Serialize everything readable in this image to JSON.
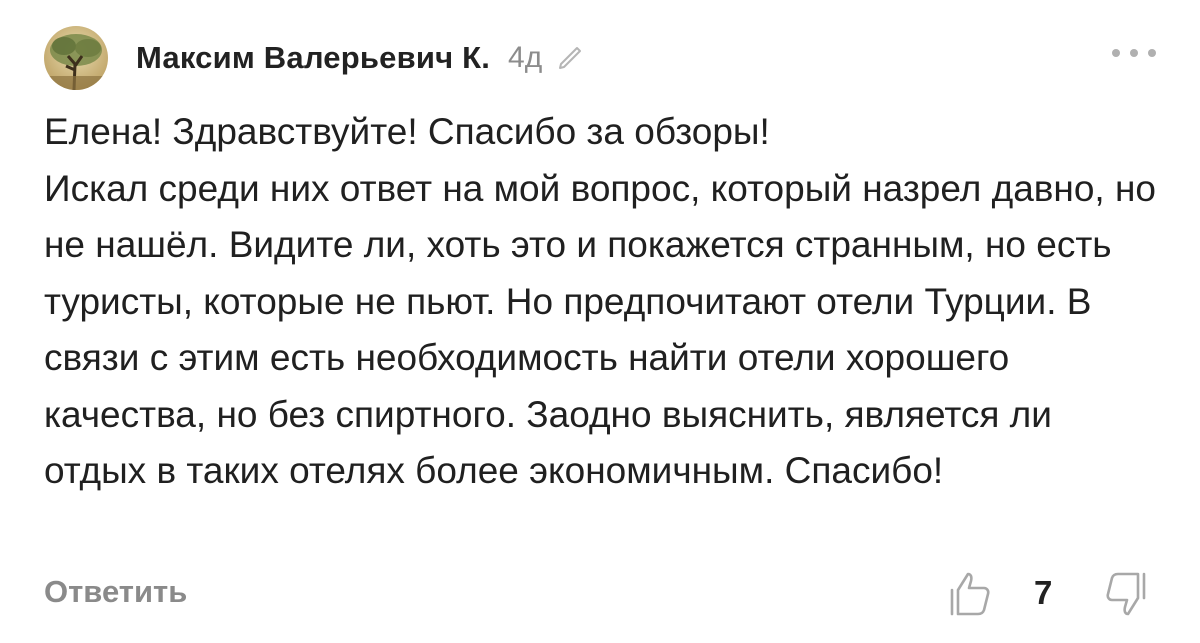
{
  "comment": {
    "author": "Максим Валерьевич К.",
    "time": "4д",
    "text": "Елена! Здравствуйте! Спасибо за обзоры!\nИскал среди них ответ на мой вопрос, который назрел давно, но не нашёл. Видите ли, хоть это и покажется странным, но есть туристы, которые не пьют. Но предпочитают отели Турции. В связи с этим есть необходимость найти отели хорошего качества, но без спиртного. Заодно выяснить, является ли отдых в таких отелях более экономичным. Спасибо!",
    "reply_label": "Ответить",
    "likes": "7"
  },
  "icons": {
    "avatar": "avatar-tree-photo",
    "edit": "pencil-icon",
    "more": "more-dots-icon",
    "like": "thumb-up-icon",
    "dislike": "thumb-down-icon"
  },
  "colors": {
    "author": "#222222",
    "muted": "#8c8c8c",
    "text": "#202020",
    "dots": "#b0b0b0"
  }
}
